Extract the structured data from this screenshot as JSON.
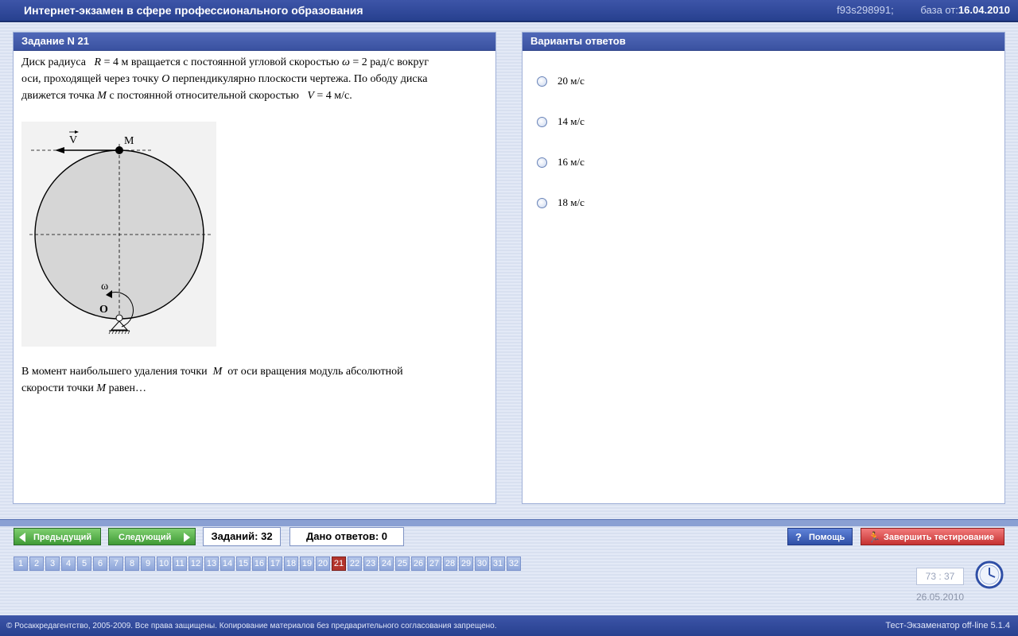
{
  "window": {
    "title": "Интернет-экзамен в сфере профессионального образования",
    "session_id": "f93s298991;",
    "db_label": "база от:",
    "db_date": "16.04.2010"
  },
  "task": {
    "header": "Задание N 21",
    "q1": "Диск радиуса",
    "R_var": "R",
    "R_val": "= 4 м вращается с постоянной угловой скоростью",
    "omega_var": "ω",
    "omega_val": "= 2 рад/с вокруг",
    "q2": "оси, проходящей через точку",
    "O_var": "O",
    "q3": "перпендикулярно плоскости чертежа. По ободу диска",
    "q4": "движется точка",
    "M_var": "M",
    "q5": "с постоянной относительной скоростью",
    "V_var": "V",
    "V_val": "= 4 м/с.",
    "q6": "В  момент  наибольшего удаления точки",
    "q7": "от оси вращения модуль абсолютной",
    "q8": "скорости точки",
    "q9": "равен…",
    "figure": {
      "label_V": "V",
      "label_M": "M",
      "label_omega": "ω",
      "label_O": "O"
    }
  },
  "answers": {
    "header": "Варианты ответов",
    "options": [
      "20 м/с",
      "14 м/с",
      "16 м/с",
      "18 м/с"
    ]
  },
  "nav": {
    "prev_label": "Предыдущий",
    "next_label": "Следующий",
    "tasks_count": "Заданий: 32",
    "answers_given": "Дано ответов: 0",
    "help_label": "Помощь",
    "finish_label": "Завершить тестирование",
    "pages": [
      "1",
      "2",
      "3",
      "4",
      "5",
      "6",
      "7",
      "8",
      "9",
      "10",
      "11",
      "12",
      "13",
      "14",
      "15",
      "16",
      "17",
      "18",
      "19",
      "20",
      "21",
      "22",
      "23",
      "24",
      "25",
      "26",
      "27",
      "28",
      "29",
      "30",
      "31",
      "32"
    ],
    "active_page": "21"
  },
  "status": {
    "timer": "73 : 37",
    "date": "26.05.2010"
  },
  "footer": {
    "copyright": "© Росаккредагентство, 2005-2009. Все права защищены. Копирование материалов без предварительного согласования запрещено.",
    "version": "Тест-Экзаменатор off-line 5.1.4"
  },
  "colors": {
    "accent": "#3a52a0",
    "active_page": "#b3342c",
    "button_green": "#3f9a36",
    "button_red": "#c53232"
  }
}
